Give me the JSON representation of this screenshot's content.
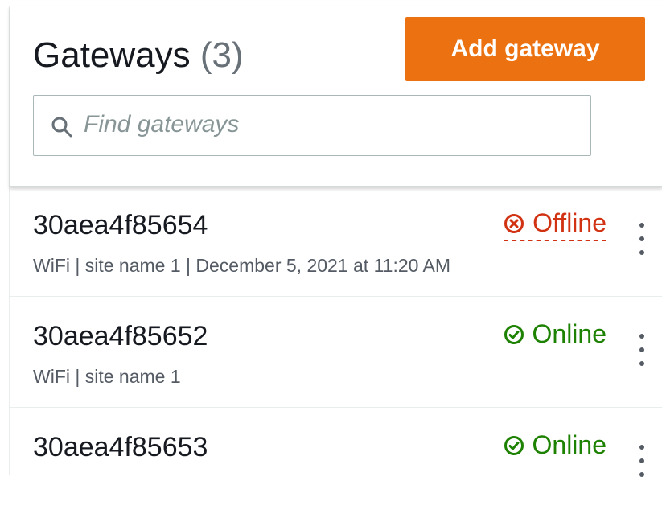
{
  "header": {
    "title": "Gateways",
    "count": "(3)",
    "add_button_label": "Add gateway"
  },
  "search": {
    "placeholder": "Find gateways",
    "value": ""
  },
  "gateways": [
    {
      "id": "30aea4f85654",
      "meta": "WiFi | site name 1 | December 5, 2021 at 11:20 AM",
      "status": "Offline",
      "status_icon": "error-circle-icon",
      "status_color": "#d13212"
    },
    {
      "id": "30aea4f85652",
      "meta": "WiFi | site name 1",
      "status": "Online",
      "status_icon": "success-circle-icon",
      "status_color": "#1d8102"
    },
    {
      "id": "30aea4f85653",
      "meta": "",
      "status": "Online",
      "status_icon": "success-circle-icon",
      "status_color": "#1d8102"
    }
  ],
  "colors": {
    "accent": "#ec7211",
    "text": "#16191f",
    "muted": "#687078"
  }
}
